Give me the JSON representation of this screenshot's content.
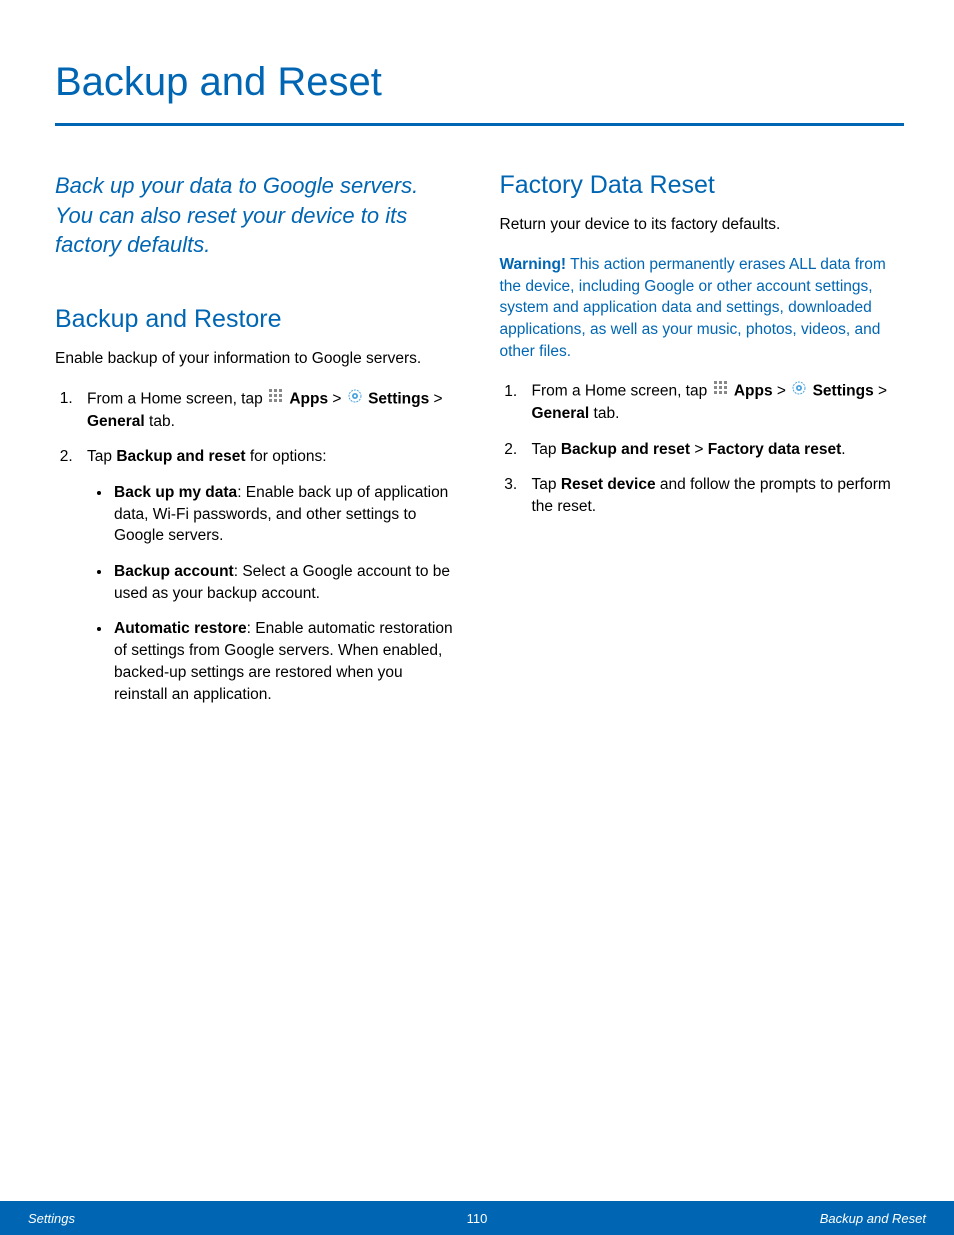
{
  "title": "Backup and Reset",
  "intro": "Back up your data to Google servers. You can also reset your device to its factory defaults.",
  "left": {
    "heading": "Backup and Restore",
    "lead": "Enable backup of your information to Google servers.",
    "step1_a": "From a Home screen, tap ",
    "step1_apps": "Apps",
    "step1_sep": " > ",
    "step1_settings": "Settings",
    "step1_b": " > ",
    "step1_general": "General",
    "step1_tab": " tab.",
    "step2_a": "Tap ",
    "step2_bold": "Backup and reset",
    "step2_b": " for options:",
    "bullets": {
      "b1_bold": "Back up my data",
      "b1_rest": ": Enable back up of application data, Wi-Fi passwords, and other settings to Google servers.",
      "b2_bold": "Backup account",
      "b2_rest": ": Select a Google account to be used as your backup account.",
      "b3_bold": "Automatic restore",
      "b3_rest": ": Enable automatic restoration of settings from Google servers. When enabled, backed-up settings are restored when you reinstall an application."
    }
  },
  "right": {
    "heading": "Factory Data Reset",
    "lead": "Return your device to its factory defaults.",
    "warning_label": "Warning!",
    "warning_text": " This action permanently erases ALL data from the device, including Google or other account settings, system and application data and settings, downloaded applications, as well as your music, photos, videos, and other files.",
    "step1_a": "From a Home screen, tap ",
    "step1_apps": "Apps",
    "step1_sep": " > ",
    "step1_settings": "Settings",
    "step1_b": " > ",
    "step1_general": "General",
    "step1_tab": " tab.",
    "step2_a": "Tap ",
    "step2_bold1": "Backup and reset",
    "step2_sep": " > ",
    "step2_bold2": "Factory data reset",
    "step2_end": ".",
    "step3_a": "Tap ",
    "step3_bold": "Reset device",
    "step3_b": " and follow the prompts to perform the reset."
  },
  "footer": {
    "left": "Settings",
    "center": "110",
    "right": "Backup and Reset"
  }
}
